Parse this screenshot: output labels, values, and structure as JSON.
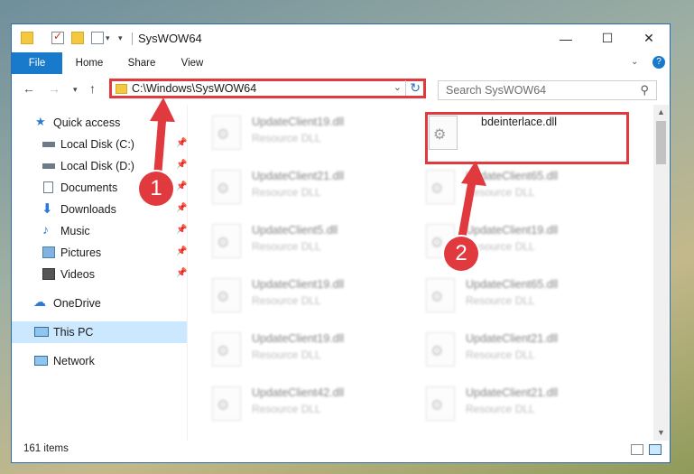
{
  "window": {
    "title": "SysWOW64"
  },
  "ribbon": {
    "tabs": [
      "File",
      "Home",
      "Share",
      "View"
    ]
  },
  "address": {
    "path": "C:\\Windows\\SysWOW64",
    "search_placeholder": "Search SysWOW64"
  },
  "nav": {
    "quick_access": "Quick access",
    "items": [
      "Local Disk (C:)",
      "Local Disk (D:)",
      "Documents",
      "Downloads",
      "Music",
      "Pictures",
      "Videos"
    ],
    "onedrive": "OneDrive",
    "thispc": "This PC",
    "network": "Network"
  },
  "files": {
    "highlighted": {
      "name": "bdeinterlace.dll"
    },
    "left": [
      {
        "name": "UpdateClient19.dll",
        "type": "Resource DLL"
      },
      {
        "name": "UpdateClient21.dll",
        "type": "Resource DLL"
      },
      {
        "name": "UpdateClient5.dll",
        "type": "Resource DLL"
      },
      {
        "name": "UpdateClient19.dll",
        "type": "Resource DLL"
      },
      {
        "name": "UpdateClient19.dll",
        "type": "Resource DLL"
      },
      {
        "name": "UpdateClient42.dll",
        "type": "Resource DLL"
      }
    ],
    "right": [
      {
        "name": "UpdateClient65.dll",
        "type": "Resource DLL"
      },
      {
        "name": "UpdateClient19.dll",
        "type": "Resource DLL"
      },
      {
        "name": "UpdateClient65.dll",
        "type": "Resource DLL"
      },
      {
        "name": "UpdateClient21.dll",
        "type": "Resource DLL"
      },
      {
        "name": "UpdateClient21.dll",
        "type": "Resource DLL"
      }
    ]
  },
  "status": {
    "count": "161 items"
  },
  "annotations": {
    "step1": "1",
    "step2": "2"
  },
  "colors": {
    "accent": "#1979ca",
    "highlight": "#e0393e"
  }
}
